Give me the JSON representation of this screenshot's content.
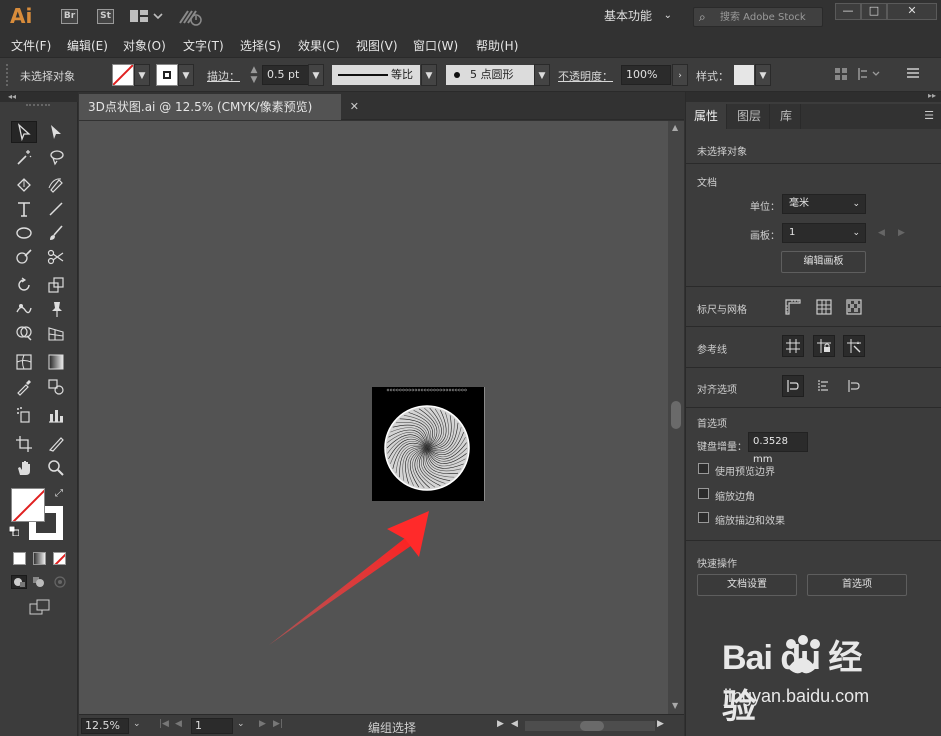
{
  "titlebar": {
    "app_logo": "Ai",
    "badge_br": "Br",
    "badge_st": "St",
    "workspace": "基本功能",
    "stock_placeholder": "搜索 Adobe Stock",
    "win_min": "—",
    "win_max": "□",
    "win_close": "✕"
  },
  "menu": {
    "items": [
      "文件(F)",
      "编辑(E)",
      "对象(O)",
      "文字(T)",
      "选择(S)",
      "效果(C)",
      "视图(V)",
      "窗口(W)",
      "帮助(H)"
    ]
  },
  "control": {
    "no_selection": "未选择对象",
    "stroke_label": "描边：",
    "stroke_value": "0.5 pt",
    "profile": "等比",
    "brush": "5 点圆形",
    "opacity_label": "不透明度：",
    "opacity_value": "100%",
    "style_label": "样式："
  },
  "document": {
    "tab_title": "3D点状图.ai @ 12.5% (CMYK/像素预览)",
    "tab_close": "✕"
  },
  "status": {
    "zoom": "12.5%",
    "artboard_num": "1",
    "selection_info": "编组选择"
  },
  "properties": {
    "tabs": [
      "属性",
      "图层",
      "库"
    ],
    "no_selection": "未选择对象",
    "doc_section": "文档",
    "units_label": "单位：",
    "units_value": "毫米",
    "artboard_label": "画板：",
    "artboard_value": "1",
    "edit_artboards": "编辑画板",
    "rulers_grids": "标尺与网格",
    "guides": "参考线",
    "align_options": "对齐选项",
    "preferences": "首选项",
    "key_increment_label": "键盘增量：",
    "key_increment_value": "0.3528 mm",
    "use_preview_bounds": "使用预览边界",
    "scale_corners": "缩放边角",
    "scale_strokes_effects": "缩放描边和效果",
    "quick_actions": "快速操作",
    "document_setup": "文档设置",
    "preferences_btn": "首选项"
  },
  "watermark": {
    "logo": "Bai du 经验",
    "url": "jingyan.baidu.com"
  },
  "colors": {
    "accent": "#d88c3b",
    "arrow": "#ff3b3b",
    "canvas": "#535353"
  }
}
